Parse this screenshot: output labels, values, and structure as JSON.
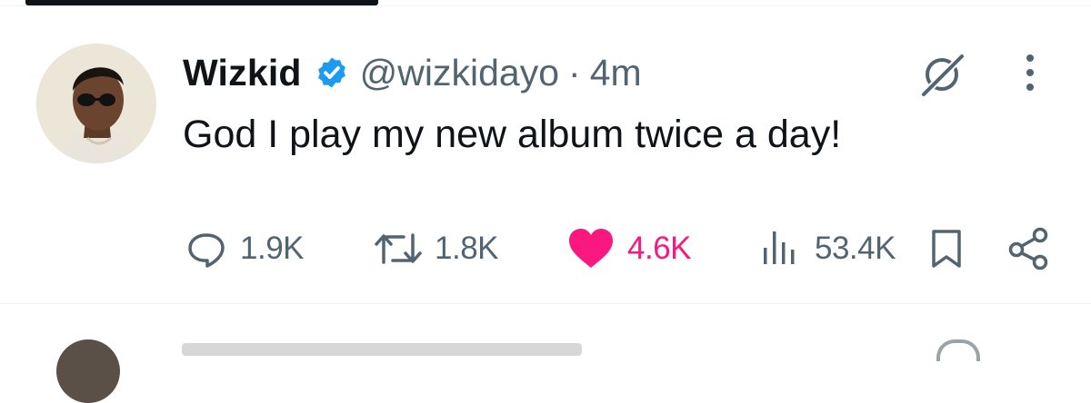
{
  "tweet": {
    "author": {
      "display_name": "Wizkid",
      "handle": "@wizkidayo",
      "verified": true
    },
    "separator": "·",
    "time": "4m",
    "text": "God I play my new album twice a day!",
    "stats": {
      "replies": "1.9K",
      "reposts": "1.8K",
      "likes": "4.6K",
      "views": "53.4K"
    },
    "liked": true
  },
  "colors": {
    "text": "#0f1419",
    "muted": "#536471",
    "like": "#f91880",
    "verified": "#1d9bf0",
    "divider": "#eff3f4"
  },
  "icons": {
    "verified": "verified-badge-icon",
    "grok": "grok-icon",
    "more": "more-vertical-icon",
    "reply": "reply-icon",
    "repost": "repost-icon",
    "like": "heart-icon",
    "views": "views-icon",
    "bookmark": "bookmark-icon",
    "share": "share-icon"
  }
}
